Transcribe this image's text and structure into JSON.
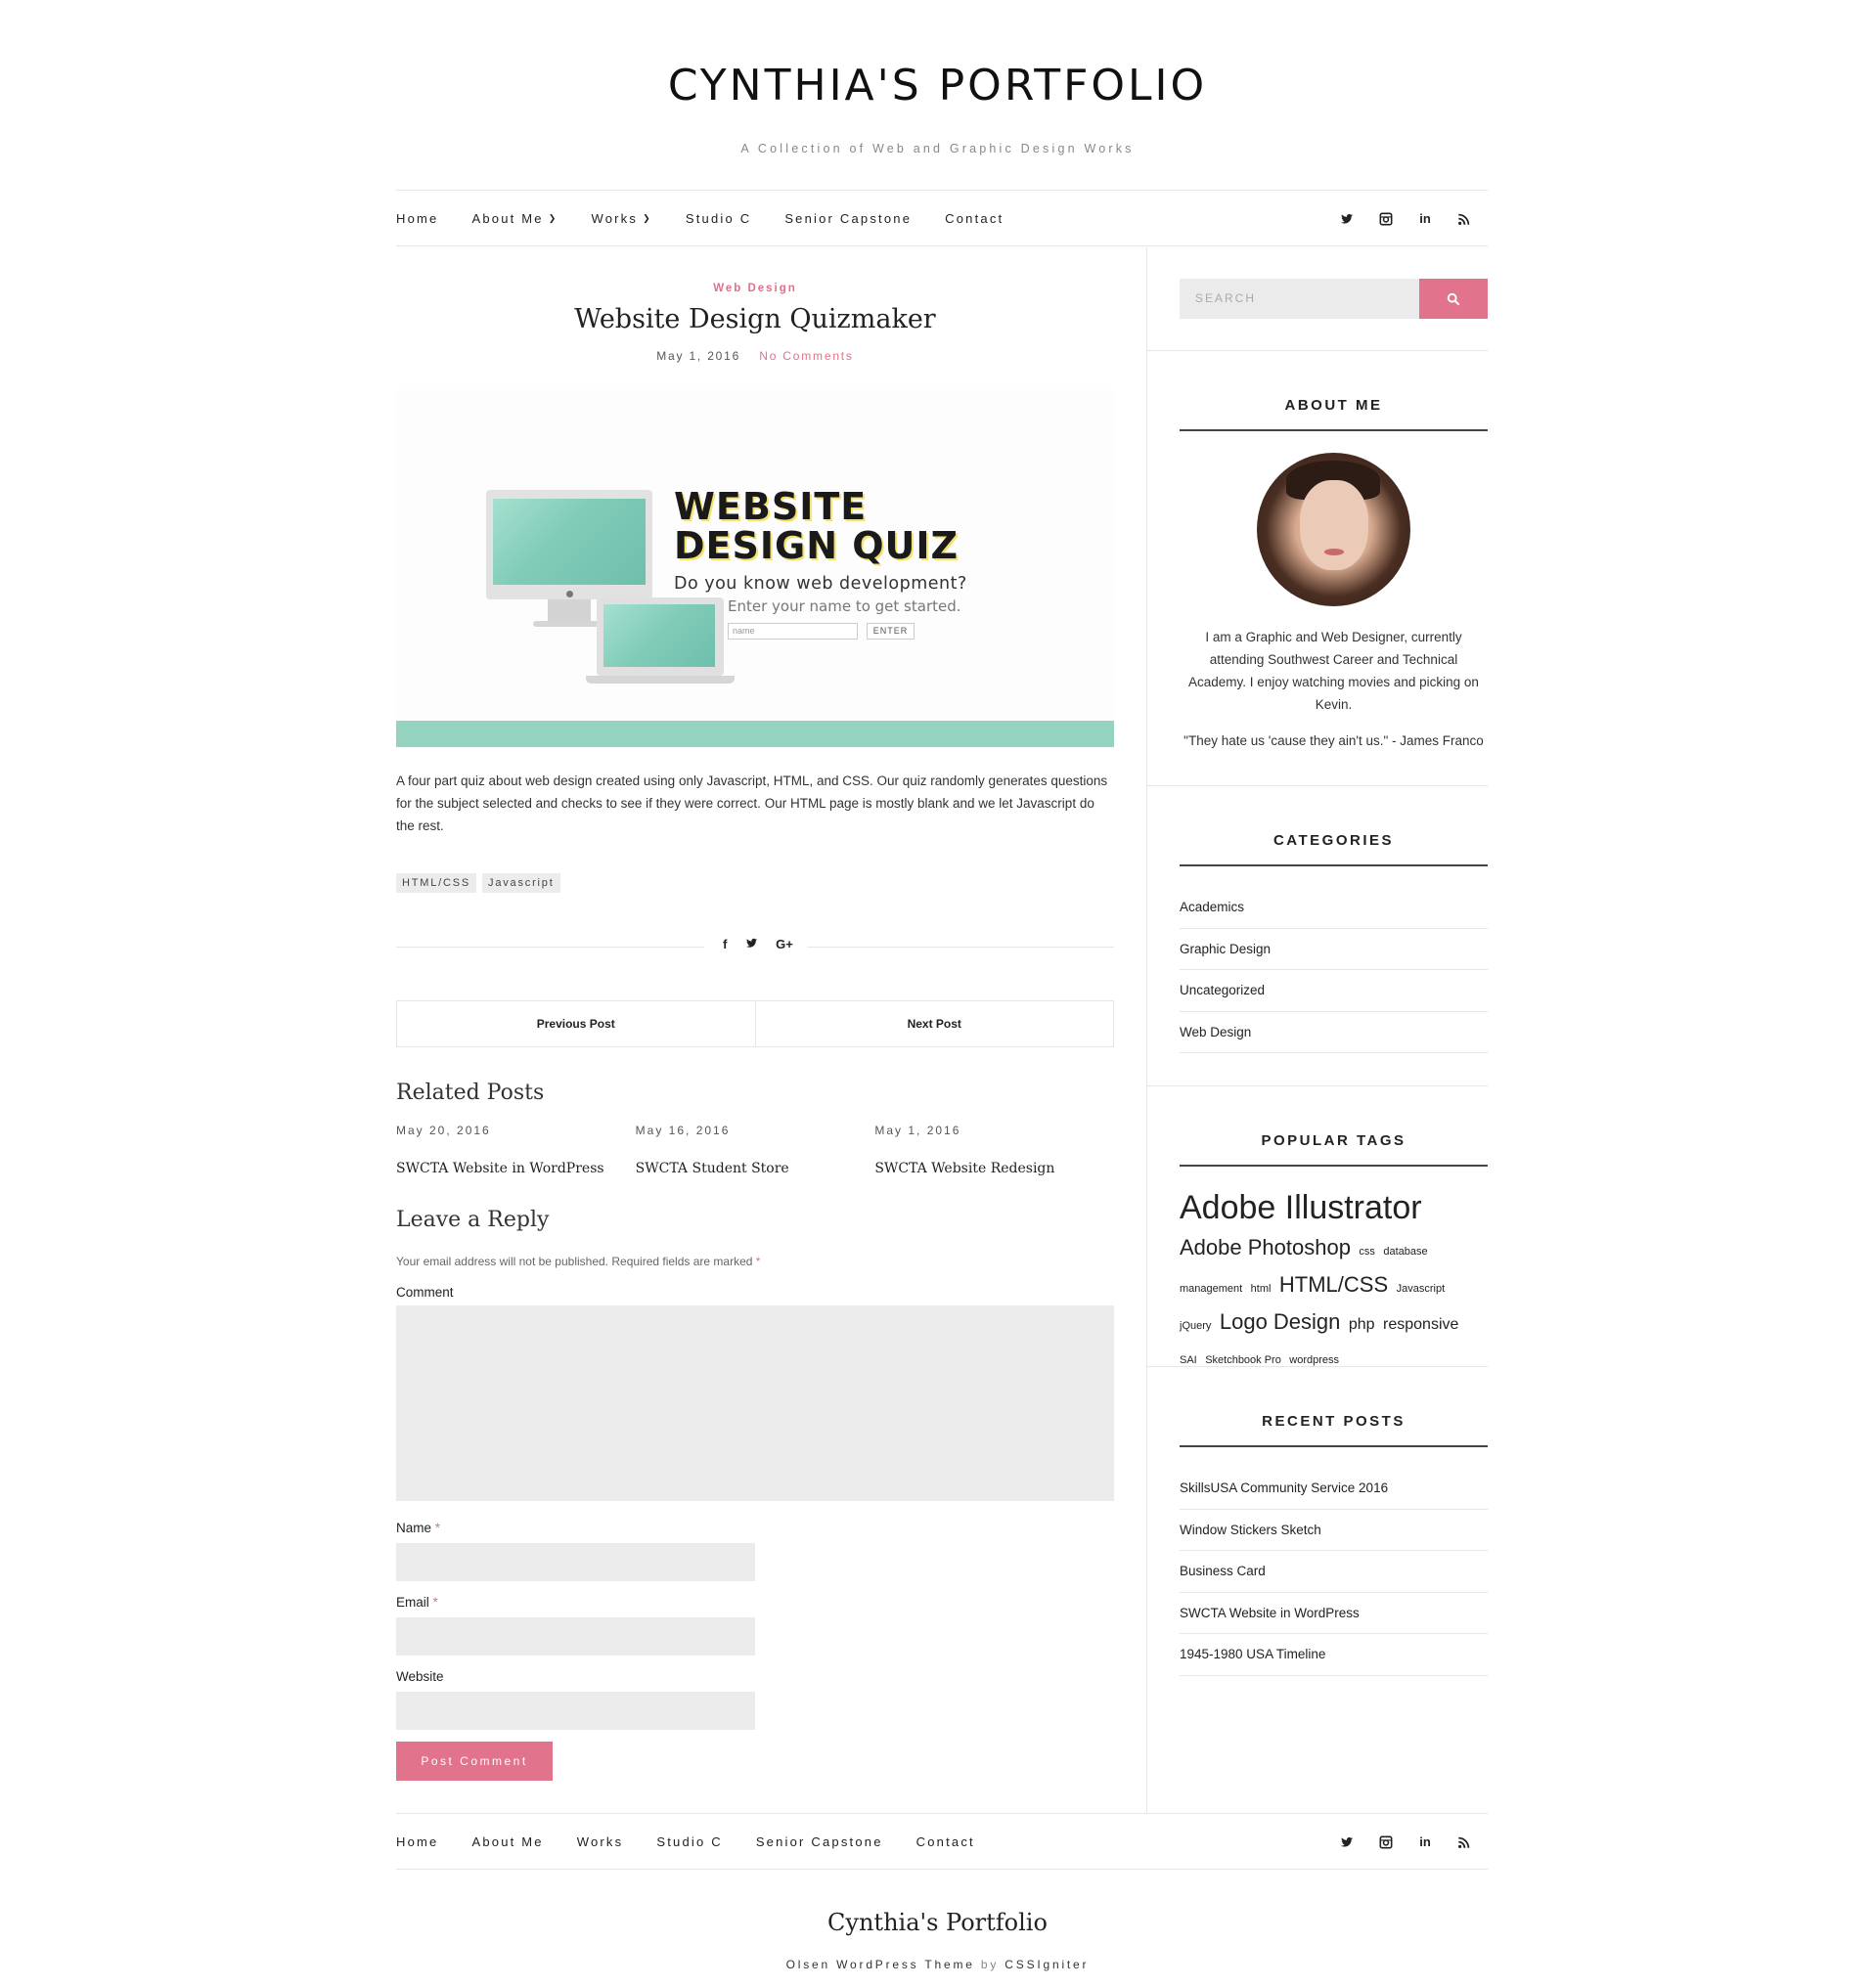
{
  "site": {
    "title": "CYNTHIA'S PORTFOLIO",
    "tagline": "A Collection of Web and Graphic Design Works"
  },
  "nav": {
    "items": [
      {
        "label": "Home"
      },
      {
        "label": "About Me"
      },
      {
        "label": "Works"
      },
      {
        "label": "Studio C"
      },
      {
        "label": "Senior Capstone"
      },
      {
        "label": "Contact"
      }
    ],
    "socials": [
      "twitter-icon",
      "instagram-icon",
      "linkedin-icon",
      "rss-icon"
    ],
    "linkedin_text": "in"
  },
  "post": {
    "category": "Web Design",
    "title": "Website Design Quizmaker",
    "date": "May 1, 2016",
    "comments": "No Comments",
    "image": {
      "line1": "WEBSITE",
      "line2": "DESIGN QUIZ",
      "sub": "Do you know web development?",
      "sub2": "Enter your name to get started.",
      "placeholder": "name",
      "button": "ENTER"
    },
    "body": "A four part quiz about web design created using only Javascript, HTML, and CSS. Our quiz randomly generates questions for the subject selected and checks to see if they were correct. Our HTML page is mostly blank and we let Javascript do the rest.",
    "tags": [
      "HTML/CSS",
      "Javascript"
    ],
    "prev": "Previous Post",
    "next": "Next Post"
  },
  "related": {
    "heading": "Related Posts",
    "items": [
      {
        "date": "May 20, 2016",
        "title": "SWCTA Website in WordPress"
      },
      {
        "date": "May 16, 2016",
        "title": "SWCTA Student Store"
      },
      {
        "date": "May 1, 2016",
        "title": "SWCTA Website Redesign"
      }
    ]
  },
  "reply": {
    "heading": "Leave a Reply",
    "note": "Your email address will not be published. Required fields are marked",
    "required_mark": "*",
    "comment_label": "Comment",
    "name_label": "Name",
    "email_label": "Email",
    "website_label": "Website",
    "submit": "Post Comment"
  },
  "sidebar": {
    "search_placeholder": "SEARCH",
    "about": {
      "title": "ABOUT ME",
      "text": "I am a Graphic and Web Designer, currently attending Southwest Career and Technical Academy. I enjoy watching movies and picking on Kevin.",
      "quote": "\"They hate us 'cause they ain't us.\" - James Franco"
    },
    "categories": {
      "title": "CATEGORIES",
      "items": [
        "Academics",
        "Graphic Design",
        "Uncategorized",
        "Web Design"
      ]
    },
    "tags": {
      "title": "POPULAR TAGS",
      "items": [
        {
          "label": "Adobe Illustrator",
          "size": 34
        },
        {
          "label": "Adobe Photoshop",
          "size": 22
        },
        {
          "label": "css",
          "size": 11
        },
        {
          "label": "database management",
          "size": 11
        },
        {
          "label": "html",
          "size": 11
        },
        {
          "label": "HTML/CSS",
          "size": 22
        },
        {
          "label": "Javascript",
          "size": 11
        },
        {
          "label": "jQuery",
          "size": 11
        },
        {
          "label": "Logo Design",
          "size": 22
        },
        {
          "label": "php",
          "size": 16
        },
        {
          "label": "responsive",
          "size": 16
        },
        {
          "label": "SAI",
          "size": 11
        },
        {
          "label": "Sketchbook Pro",
          "size": 11
        },
        {
          "label": "wordpress",
          "size": 11
        }
      ]
    },
    "recent": {
      "title": "RECENT POSTS",
      "items": [
        "SkillsUSA Community Service 2016",
        "Window Stickers Sketch",
        "Business Card",
        "SWCTA Website in WordPress",
        "1945-1980 USA Timeline"
      ]
    }
  },
  "footer": {
    "title": "Cynthia's Portfolio",
    "credit_theme": "Olsen WordPress Theme",
    "credit_by": "by",
    "credit_author": "CSSIgniter"
  }
}
